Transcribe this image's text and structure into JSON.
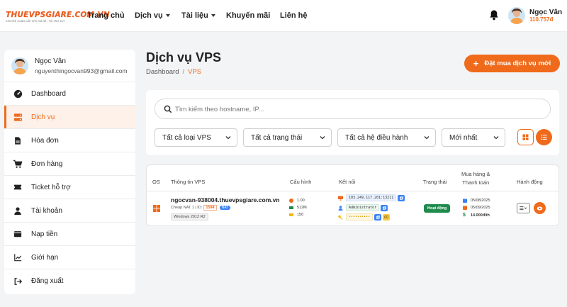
{
  "header": {
    "logo_text": "THUEVPSGIARE.COM.VN",
    "logo_tagline": "CHUYÊN CUNG CẤP VPS GIÁ RẺ - HỖ TRỢ 24/7",
    "menu": [
      {
        "label": "Trang chủ"
      },
      {
        "label": "Dịch vụ"
      },
      {
        "label": "Tài liệu"
      },
      {
        "label": "Khuyến mãi"
      },
      {
        "label": "Liên hệ"
      }
    ],
    "user_name": "Ngọc Vân",
    "user_balance": "110.757đ"
  },
  "sidebar": {
    "user_name": "Ngọc Vân",
    "user_email": "nguyenthingocvan993@gmail.com",
    "items": [
      {
        "label": "Dashboard",
        "icon": "dashboard-icon"
      },
      {
        "label": "Dịch vụ",
        "icon": "server-icon"
      },
      {
        "label": "Hóa đơn",
        "icon": "invoice-icon"
      },
      {
        "label": "Đơn hàng",
        "icon": "cart-icon"
      },
      {
        "label": "Ticket hỗ trợ",
        "icon": "ticket-icon"
      },
      {
        "label": "Tài khoản",
        "icon": "user-icon"
      },
      {
        "label": "Nạp tiền",
        "icon": "wallet-icon"
      },
      {
        "label": "Giới hạn",
        "icon": "chart-line-icon"
      },
      {
        "label": "Đăng xuất",
        "icon": "logout-icon"
      }
    ]
  },
  "page": {
    "title": "Dịch vụ VPS",
    "breadcrumb_home": "Dashboard",
    "breadcrumb_current": "VPS",
    "order_button": "Đặt mua dịch vụ mới"
  },
  "filters": {
    "search_placeholder": "Tìm kiếm theo hostname, IP...",
    "type": "Tất cả loại VPS",
    "status": "Tất cả trạng thái",
    "os": "Tất cả hệ điều hành",
    "sort": "Mới nhất"
  },
  "table": {
    "headers": {
      "os": "OS",
      "info": "Thông tin VPS",
      "config": "Cấu hình",
      "connect": "Kết nối",
      "status": "Trạng thái",
      "purchase_line1": "Mua hàng &",
      "purchase_line2": "Thanh toán",
      "actions": "Hành động"
    },
    "row": {
      "hostname": "ngocvan-938004.thuevpsgiare.com.vn",
      "plan": "Cheap NAT 1 | ID:",
      "id": "1594",
      "nat_badge": "NAT",
      "os_name": "Windows 2012 R2",
      "cpu": "1.00",
      "ram": "512M",
      "disk": "150",
      "ip": "103.249.117.201:13211",
      "username": "Administrator",
      "password": "••••••••••",
      "status": "Hoạt động",
      "buy_date": "05/08/2025",
      "expire_date": "05/09/2025",
      "price": "14.000đ/th"
    }
  },
  "colors": {
    "accent": "#ef6a1b",
    "status_active": "#1f8a4c",
    "link_blue": "#3b82f6"
  }
}
